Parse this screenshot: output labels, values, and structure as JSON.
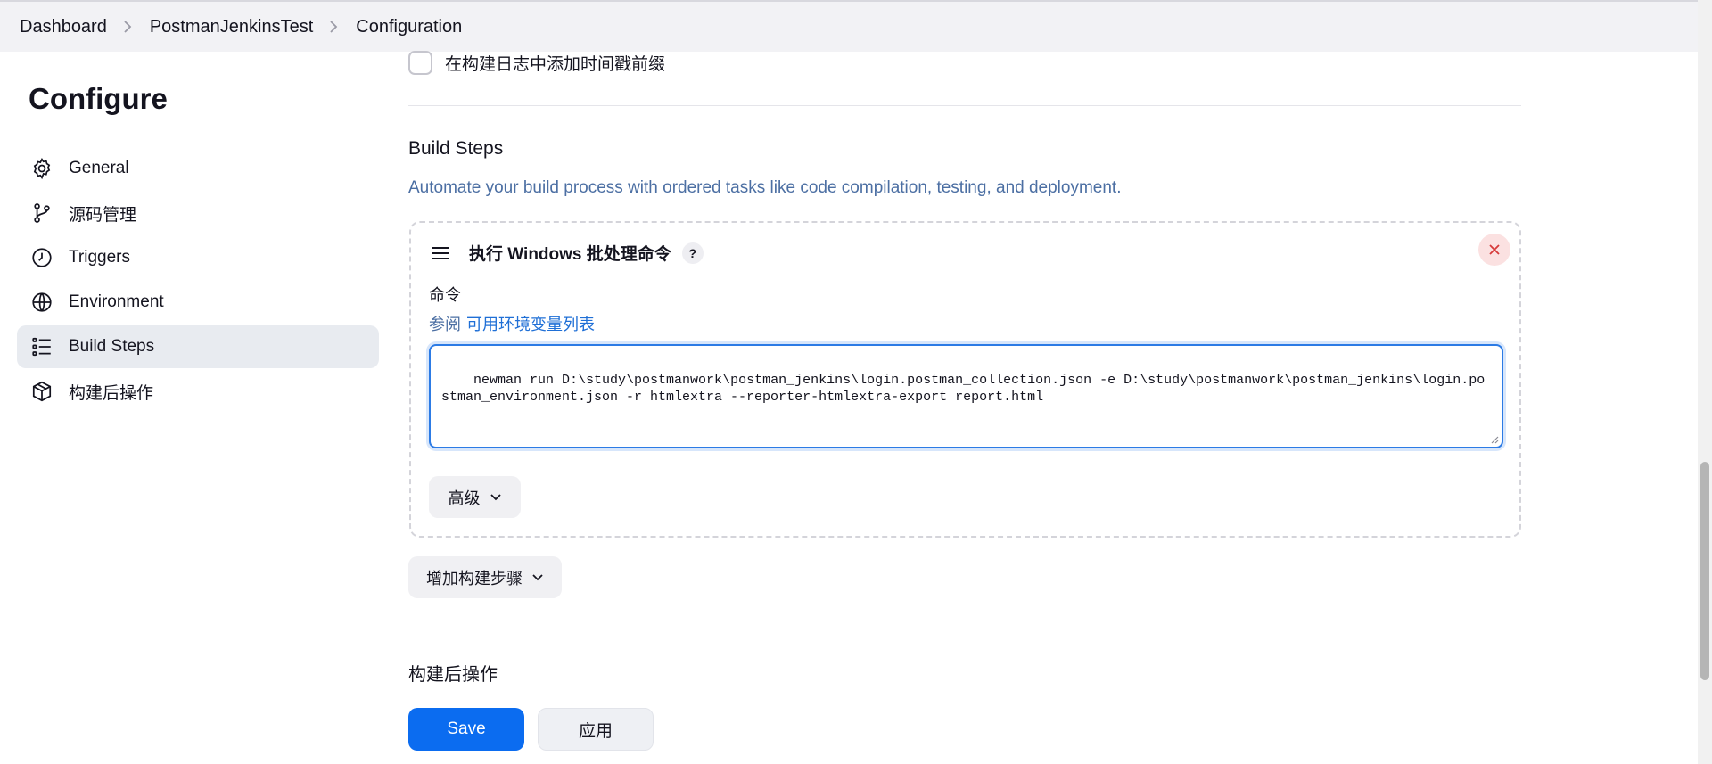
{
  "breadcrumb": [
    "Dashboard",
    "PostmanJenkinsTest",
    "Configuration"
  ],
  "page_title": "Configure",
  "sidebar": {
    "items": [
      {
        "label": "General",
        "icon": "gear-icon"
      },
      {
        "label": "源码管理",
        "icon": "branch-icon"
      },
      {
        "label": "Triggers",
        "icon": "clock-icon"
      },
      {
        "label": "Environment",
        "icon": "globe-icon"
      },
      {
        "label": "Build Steps",
        "icon": "list-icon",
        "active": true
      },
      {
        "label": "构建后操作",
        "icon": "package-icon"
      }
    ]
  },
  "main": {
    "timestamp_checkbox_label": "在构建日志中添加时间戳前缀",
    "build_steps_title": "Build Steps",
    "build_steps_desc": "Automate your build process with ordered tasks like code compilation, testing, and deployment.",
    "step": {
      "title": "执行 Windows 批处理命令",
      "help": "?",
      "command_label": "命令",
      "help_prefix": "参阅",
      "help_link": "可用环境变量列表",
      "command_value": "newman run D:\\study\\postmanwork\\postman_jenkins\\login.postman_collection.json -e D:\\study\\postmanwork\\postman_jenkins\\login.postman_environment.json -r htmlextra --reporter-htmlextra-export report.html",
      "advanced_label": "高级"
    },
    "add_step_label": "增加构建步骤",
    "post_build_title": "构建后操作"
  },
  "actions": {
    "save_label": "Save",
    "apply_label": "应用"
  },
  "colors": {
    "accent": "#0b6cf0",
    "link": "#1f6fd6",
    "active_bg": "#e8ebf0"
  }
}
